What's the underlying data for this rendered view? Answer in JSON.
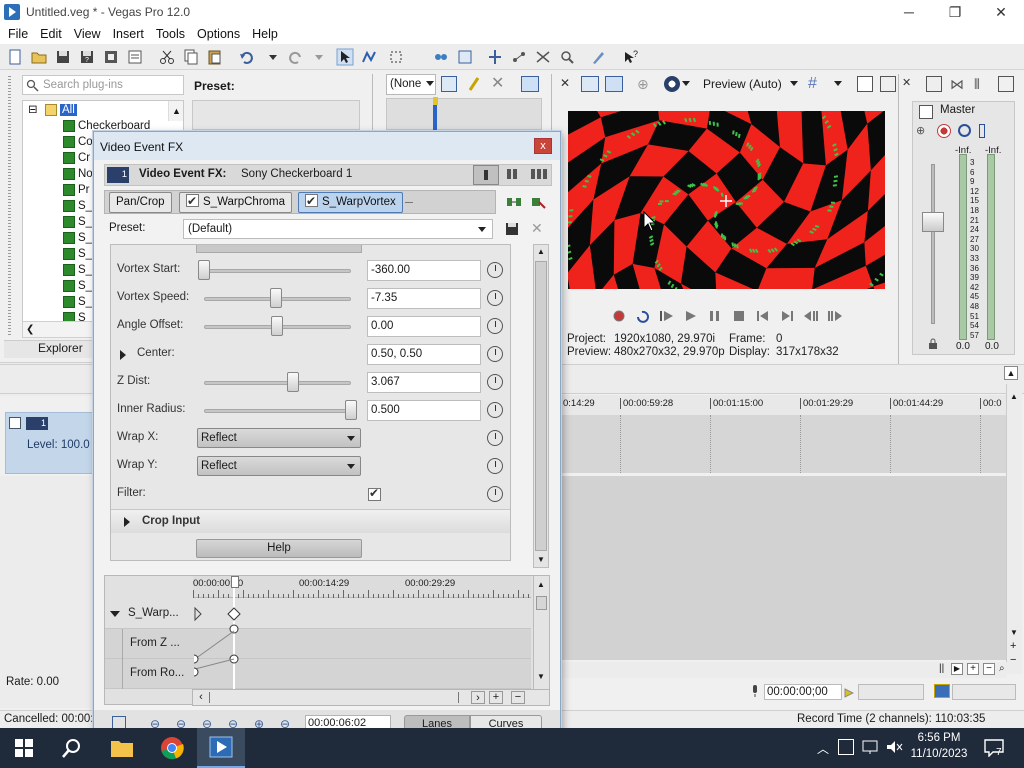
{
  "window": {
    "title": "Untitled.veg * - Vegas Pro 12.0",
    "minimize_glyph": "─",
    "maximize_glyph": "❐",
    "close_glyph": "✕"
  },
  "menu": [
    "File",
    "Edit",
    "View",
    "Insert",
    "Tools",
    "Options",
    "Help"
  ],
  "explorer": {
    "search_placeholder": "Search plug-ins",
    "preset_label": "Preset:",
    "tree_root": "All",
    "tree_items": [
      "Checkerboard",
      "Co",
      "Cr",
      "No",
      "Pr",
      "S_",
      "S_",
      "S_",
      "S_",
      "S_",
      "S_",
      "S_",
      "S_",
      "S_"
    ],
    "tab_label": "Explorer"
  },
  "trimmer": {
    "dropdown_value": "(None"
  },
  "dialog": {
    "title": "Video Event FX",
    "close_glyph": "x",
    "track_badge": "1",
    "header_label": "Video Event FX:",
    "header_value": "Sony Checkerboard 1",
    "chain": [
      {
        "label": "Pan/Crop",
        "checked": false,
        "selected": false
      },
      {
        "label": "S_WarpChroma",
        "checked": true,
        "selected": false
      },
      {
        "label": "S_WarpVortex",
        "checked": true,
        "selected": true
      }
    ],
    "preset_label": "Preset:",
    "preset_value": "(Default)",
    "params": [
      {
        "kind": "slider",
        "label": "Vortex Start:",
        "value": "-360.00",
        "level": 0.0
      },
      {
        "kind": "slider",
        "label": "Vortex Speed:",
        "value": "-7.35",
        "level": 0.49
      },
      {
        "kind": "slider",
        "label": "Angle Offset:",
        "value": "0.00",
        "level": 0.5
      },
      {
        "kind": "expand",
        "label": "Center:",
        "value": "0.50, 0.50"
      },
      {
        "kind": "slider",
        "label": "Z Dist:",
        "value": "3.067",
        "level": 0.61
      },
      {
        "kind": "slider",
        "label": "Inner Radius:",
        "value": "0.500",
        "level": 1.0
      },
      {
        "kind": "dropdown",
        "label": "Wrap X:",
        "value": "Reflect"
      },
      {
        "kind": "dropdown",
        "label": "Wrap Y:",
        "value": "Reflect"
      },
      {
        "kind": "checkbox",
        "label": "Filter:",
        "value": true
      }
    ],
    "crop_input_label": "Crop Input",
    "help_label": "Help",
    "keyframes": {
      "ruler": [
        "00:00:00:00",
        "00:00:14:29",
        "00:00:29:29"
      ],
      "rows": [
        {
          "label": "S_Warp..."
        },
        {
          "label": "From Z ..."
        },
        {
          "label": "From Ro..."
        }
      ]
    },
    "bottom": {
      "time_value": "00:00:06:02",
      "tab_lanes": "Lanes",
      "tab_curves": "Curves"
    }
  },
  "preview": {
    "mode_label": "Preview (Auto)",
    "project_label": "Project:",
    "project_value": "1920x1080, 29.970i",
    "frame_label": "Frame:",
    "frame_value": "0",
    "preview_label": "Preview:",
    "preview_value": "480x270x32, 29.970p",
    "display_label": "Display:",
    "display_value": "317x178x32",
    "colors": {
      "red": "#f0231c",
      "black": "#0a0a0a",
      "green": "#3ec24a"
    }
  },
  "mixer": {
    "master_label": "Master",
    "inf_left": "-Inf.",
    "inf_right": "-Inf.",
    "scale": [
      "3",
      "6",
      "9",
      "12",
      "15",
      "18",
      "21",
      "24",
      "27",
      "30",
      "33",
      "36",
      "39",
      "42",
      "45",
      "48",
      "51",
      "54",
      "57"
    ],
    "db_left": "0.0",
    "db_right": "0.0"
  },
  "timeline": {
    "ruler": [
      "0:14:29",
      "00:00:59:28",
      "00:01:15:00",
      "00:01:29:29",
      "00:01:44:29",
      "00:0"
    ],
    "track_number": "1",
    "level_label": "Level: 100.0",
    "rate_label": "Rate: 0.00",
    "time_display": "00:00:00;00"
  },
  "status": {
    "left_text": "Cancelled: 00:00:5",
    "record_time": "Record Time (2 channels): 110:03:35"
  },
  "taskbar": {
    "time": "6:56 PM",
    "date": "11/10/2023",
    "notification_count": "7"
  }
}
